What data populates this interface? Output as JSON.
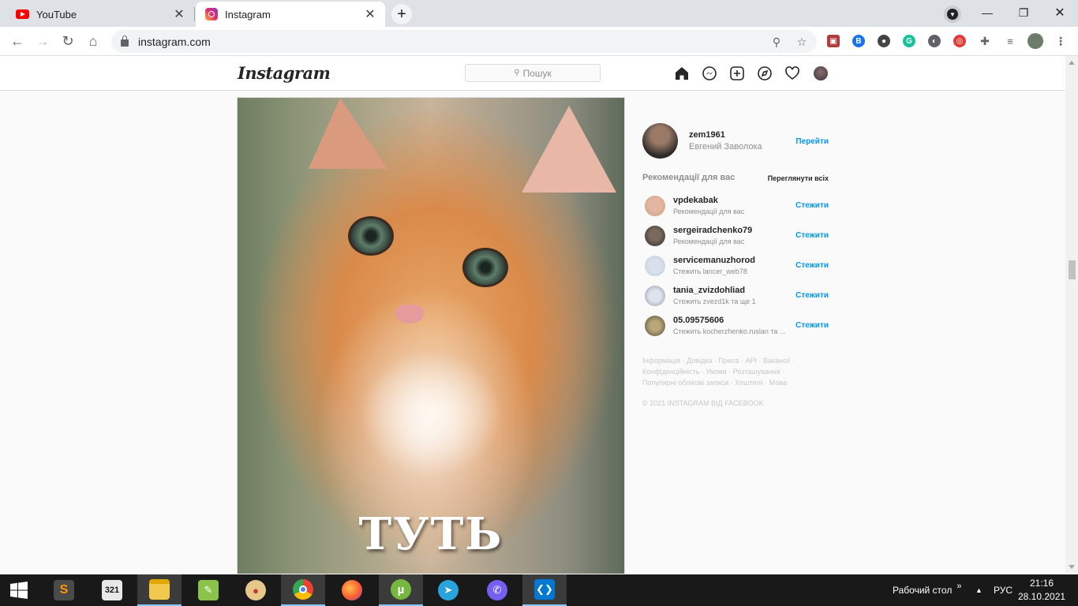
{
  "browser": {
    "tabs": [
      {
        "title": "YouTube",
        "active": false
      },
      {
        "title": "Instagram",
        "active": true
      }
    ],
    "url": "instagram.com"
  },
  "instagram": {
    "logo": "Instagram",
    "search_placeholder": "Пошук",
    "post": {
      "caption": "ТУТЬ"
    },
    "current_user": {
      "username": "zem1961",
      "full_name": "Евгений Заволока",
      "switch_label": "Перейти"
    },
    "suggestions_title": "Рекомендації для вас",
    "see_all": "Переглянути всіх",
    "suggestions": [
      {
        "username": "vpdekabak",
        "subtitle": "Рекомендації для вас",
        "action": "Стежити"
      },
      {
        "username": "sergeiradchenko79",
        "subtitle": "Рекомендації для вас",
        "action": "Стежити"
      },
      {
        "username": "servicemanuzhorod",
        "subtitle": "Стежить lancer_web78",
        "action": "Стежити"
      },
      {
        "username": "tania_zvizdohliad",
        "subtitle": "Стежить zvezd1k та ще 1",
        "action": "Стежити"
      },
      {
        "username": "05.09575606",
        "subtitle": "Стежить kocherzhenko.ruslan та ...",
        "action": "Стежити"
      }
    ],
    "footer_links": [
      "Інформація",
      "Довідка",
      "Преса",
      "API",
      "Вакансії",
      "Конфіденційність",
      "Умови",
      "Розташування",
      "Популярні облікові записи",
      "Хештеги",
      "Мова"
    ],
    "copyright": "© 2021 INSTAGRAM ВІД FACEBOOK"
  },
  "taskbar": {
    "desktop_label": "Рабочий стол",
    "language": "РУС",
    "time": "21:16",
    "date": "28.10.2021",
    "apps": [
      "start",
      "sublime-text",
      "media-player-classic",
      "file-explorer",
      "notepad-plus",
      "paint",
      "chrome",
      "firefox",
      "utorrent",
      "telegram",
      "viber",
      "vscode"
    ]
  },
  "colors": {
    "ig_blue": "#0095f6",
    "tab_strip": "#dee1e6",
    "taskbar": "#191919"
  }
}
